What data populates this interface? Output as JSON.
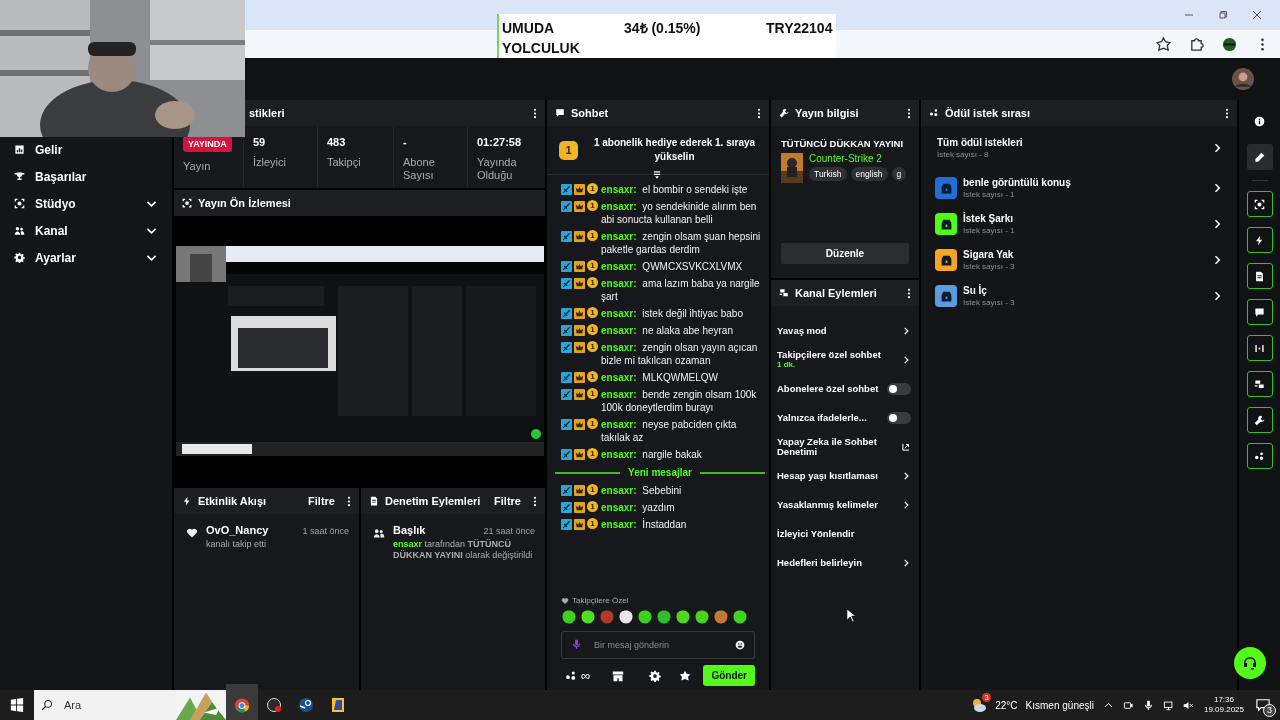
{
  "browser": {
    "ticker": [
      "UMUDA YOLCULUK",
      "34₺ (0.15%)",
      "TRY22104"
    ]
  },
  "sidebar": {
    "items": [
      {
        "label": "Gelir",
        "kind": "link"
      },
      {
        "label": "Başarılar",
        "kind": "link"
      },
      {
        "label": "Stüdyo",
        "kind": "group"
      },
      {
        "label": "Kanal",
        "kind": "group"
      },
      {
        "label": "Ayarlar",
        "kind": "group"
      }
    ]
  },
  "stats": {
    "title": "stikleri",
    "items": [
      {
        "kind": "badge",
        "value": "YAYINDA",
        "label": "Yayın"
      },
      {
        "kind": "value",
        "value": "59",
        "label": "İzleyici"
      },
      {
        "kind": "value",
        "value": "483",
        "label": "Takipçi"
      },
      {
        "kind": "value",
        "value": "-",
        "label": "Abone Sayısı"
      },
      {
        "kind": "value",
        "value": "01:27:58",
        "label": "Yayında Olduğu"
      }
    ]
  },
  "preview": {
    "title": "Yayın Ön İzlemesi"
  },
  "activity": {
    "title": "Etkinlik Akışı",
    "filter": "Filtre",
    "events": [
      {
        "user": "OvO_Nancy",
        "time": "1 saat önce",
        "text": "kanalı takip etti"
      }
    ]
  },
  "moderation": {
    "title": "Denetim Eylemleri",
    "filter": "Filtre",
    "entries": [
      {
        "title": "Başlık",
        "time": "21 saat önce",
        "actor": "ensaxr",
        "text": "tarafından **TÜTÜNCÜ DÜKKAN YAYINI** olarak değiştirildi"
      }
    ]
  },
  "chat": {
    "title": "Sohbet",
    "hype": {
      "rank": "1",
      "text": "1 abonelik hediye ederek 1. sıraya yükselin"
    },
    "messages": [
      {
        "badge": "1",
        "user": "ensaxr:",
        "text": "el bombir o sendeki işte"
      },
      {
        "badge": "1",
        "user": "ensaxr:",
        "text": "yo sendekinide alırım ben abi sonucta kullanan belli"
      },
      {
        "badge": "1",
        "user": "ensaxr:",
        "text": "zengin olsam şuan hepsini paketle gardas derdim"
      },
      {
        "badge": "1",
        "user": "ensaxr:",
        "text": "QWMCXSVKCXLVMX"
      },
      {
        "badge": "1",
        "user": "ensaxr:",
        "text": "ama lazım baba ya nargile şart"
      },
      {
        "badge": "1",
        "user": "ensaxr:",
        "text": "istek değil ihtiyac babo"
      },
      {
        "badge": "1",
        "user": "ensaxr:",
        "text": "ne alaka abe heyran"
      },
      {
        "badge": "1",
        "user": "ensaxr:",
        "text": "zengin olsan yayın açıcan bizle mi takılcan ozaman"
      },
      {
        "badge": "1",
        "user": "ensaxr:",
        "text": "MLKQWMELQW"
      },
      {
        "badge": "1",
        "user": "ensaxr:",
        "text": "bende zengin olsam 100k 100k doneytlerdim burayı"
      },
      {
        "badge": "1",
        "user": "ensaxr:",
        "text": "neyse pabciden çıkta takılak az"
      },
      {
        "badge": "1",
        "user": "ensaxr:",
        "text": "nargile bakak"
      }
    ],
    "new_label": "Yeni mesajlar",
    "new_messages": [
      {
        "badge": "1",
        "user": "ensaxr:",
        "text": "Sebebini"
      },
      {
        "badge": "1",
        "user": "ensaxr:",
        "text": "yazdım"
      },
      {
        "badge": "1",
        "user": "ensaxr:",
        "text": "İnstaddan"
      }
    ],
    "emote_label": "Takipçilere Özel",
    "placeholder": "Bir mesaj gönderin",
    "drops": "∞",
    "send": "Gönder"
  },
  "stream_info": {
    "title": "Yayın bilgisi",
    "stream_title": "TÜTÜNCÜ DÜKKAN YAYINI",
    "category": "Counter-Strike 2",
    "tags": [
      "Turkish",
      "english",
      "g"
    ],
    "edit": "Düzenle"
  },
  "channel_actions": {
    "title": "Kanal Eylemleri",
    "items": [
      {
        "label": "Yavaş mod",
        "kind": "link"
      },
      {
        "label": "Takipçilere özel sohbet",
        "sub": "1 dk.",
        "kind": "link"
      },
      {
        "label": "Abonelere özel sohbet",
        "kind": "toggle",
        "on": false
      },
      {
        "label": "Yalnızca ifadelerle...",
        "kind": "toggle",
        "on": false
      },
      {
        "label": "Yapay Zeka ile Sohbet Denetimi",
        "kind": "external"
      },
      {
        "label": "Hesap yaşı kısıtlaması",
        "kind": "link"
      },
      {
        "label": "Yasaklanmış kelimeler",
        "kind": "link"
      },
      {
        "label": "İzleyici Yönlendir",
        "kind": "plain"
      },
      {
        "label": "Hedefleri belirleyin",
        "kind": "link"
      }
    ]
  },
  "rewards": {
    "title": "Ödül istek sırası",
    "all": {
      "label": "Tüm ödül istekleri",
      "count": "İstek sayısı - 8"
    },
    "items": [
      {
        "label": "benle görüntülü konuş",
        "count": "İstek sayısı - 1",
        "color": "#1f6fd6"
      },
      {
        "label": "İstek Şarkı",
        "count": "İstek sayısı - 1",
        "color": "#53fc18"
      },
      {
        "label": "Sigara Yak",
        "count": "İstek sayısı - 3",
        "color": "#f5a524"
      },
      {
        "label": "Su İç",
        "count": "İstek sayısı - 3",
        "color": "#5b9be0"
      }
    ]
  },
  "rail": [
    {
      "kind": "info",
      "selected": false
    },
    {
      "kind": "edit",
      "selected": true
    },
    {
      "kind": "tool",
      "selected": false
    },
    {
      "kind": "tool",
      "selected": false
    },
    {
      "kind": "tool",
      "selected": false
    },
    {
      "kind": "tool",
      "selected": false
    },
    {
      "kind": "tool",
      "selected": false
    },
    {
      "kind": "tool",
      "selected": false
    },
    {
      "kind": "tool",
      "selected": false
    },
    {
      "kind": "tool",
      "selected": false
    }
  ],
  "taskbar": {
    "search_placeholder": "Ara",
    "weather": {
      "badge": "3",
      "temp": "22°C",
      "text": "Kısmen güneşli"
    },
    "time": "17:36",
    "date": "19.09.2025",
    "notifications": "3"
  }
}
